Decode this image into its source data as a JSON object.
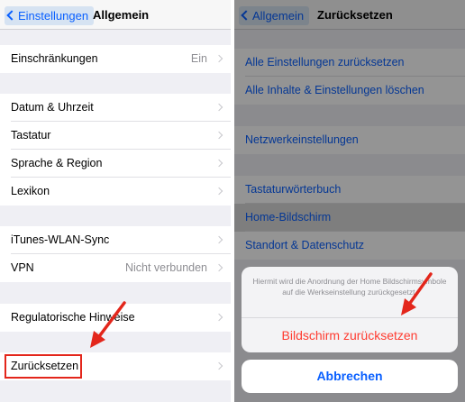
{
  "left": {
    "nav": {
      "back_label": "Einstellungen",
      "title": "Allgemein"
    },
    "rows": {
      "restrictions": {
        "label": "Einschränkungen",
        "value": "Ein"
      },
      "date_time": {
        "label": "Datum & Uhrzeit"
      },
      "keyboard": {
        "label": "Tastatur"
      },
      "language_region": {
        "label": "Sprache & Region"
      },
      "dictionary": {
        "label": "Lexikon"
      },
      "itunes_wlan_sync": {
        "label": "iTunes-WLAN-Sync"
      },
      "vpn": {
        "label": "VPN",
        "value": "Nicht verbunden"
      },
      "regulatory": {
        "label": "Regulatorische Hinweise"
      },
      "reset": {
        "label": "Zurücksetzen"
      }
    }
  },
  "right": {
    "nav": {
      "back_label": "Allgemein",
      "title": "Zurücksetzen"
    },
    "rows": {
      "reset_all_settings": "Alle Einstellungen zurücksetzen",
      "erase_all": "Alle Inhalte & Einstellungen löschen",
      "network": "Netzwerkeinstellungen",
      "keyboard_dictionary": "Tastaturwörterbuch",
      "home_screen": "Home-Bildschirm",
      "location_privacy": "Standort & Datenschutz"
    },
    "action_sheet": {
      "message": "Hiermit wird die Anordnung der Home Bildschirmsymbole auf die Werkseinstellung zurückgesetzt.",
      "action_label": "Bildschirm zurücksetzen",
      "cancel_label": "Abbrechen"
    }
  },
  "colors": {
    "ios_blue": "#0a60ff",
    "destructive_red": "#ff3b30",
    "annotation_red": "#e3261b",
    "grouped_background": "#efeff4"
  }
}
